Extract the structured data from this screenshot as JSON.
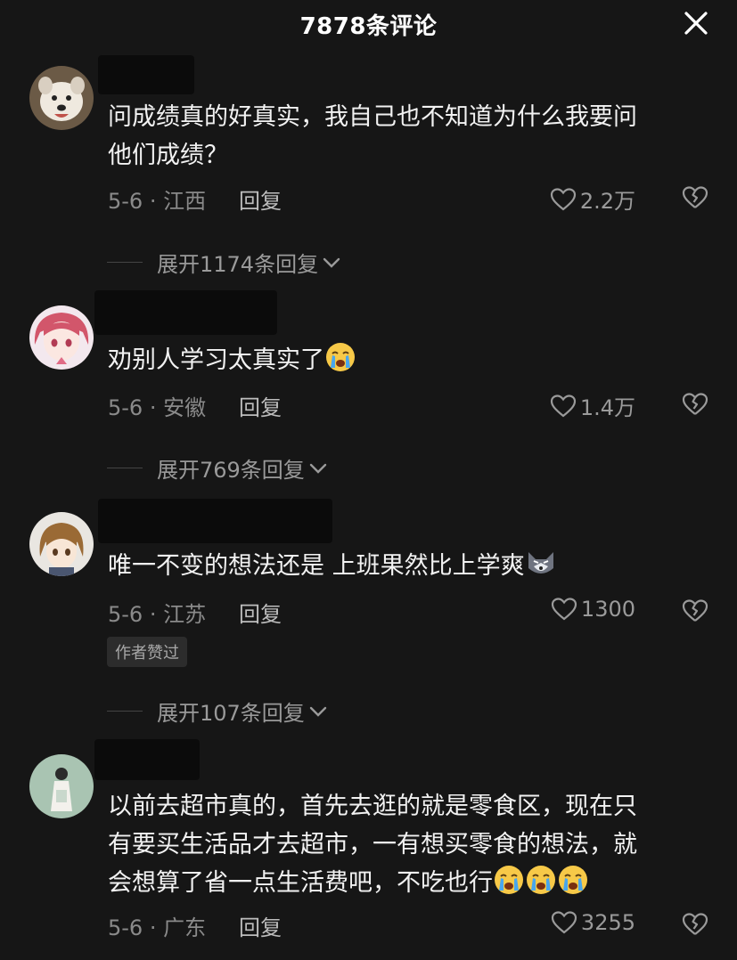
{
  "header": {
    "title": "7878条评论"
  },
  "comments": [
    {
      "text_line1": "问成绩真的好真实，我自己也不知道为什么我要问",
      "text_line2": "他们成绩？",
      "meta": "5-6 · 江西",
      "reply": "回复",
      "likes": "2.2万",
      "expand": "展开1174条回复"
    },
    {
      "text_line1": "劝别人学习太真实了",
      "meta": "5-6 · 安徽",
      "reply": "回复",
      "likes": "1.4万",
      "expand": "展开769条回复"
    },
    {
      "text_line1": "唯一不变的想法还是 上班果然比上学爽",
      "meta": "5-6 · 江苏",
      "reply": "回复",
      "likes": "1300",
      "badge": "作者赞过",
      "expand": "展开107条回复"
    },
    {
      "text_line1": "以前去超市真的，首先去逛的就是零食区，现在只",
      "text_line2": "有要买生活品才去超市，一有想买零食的想法，就",
      "text_line3": "会想算了省一点生活费吧，不吃也行",
      "meta": "5-6 · 广东",
      "reply": "回复",
      "likes": "3255"
    }
  ],
  "colors": {
    "background": "#161616",
    "text": "#f2f2f2",
    "muted": "#8a8a8a"
  },
  "icons": [
    "close-icon",
    "heart-icon",
    "broken-heart-icon",
    "chevron-down-icon",
    "crying-emoji-icon",
    "wolf-emoji-icon"
  ]
}
